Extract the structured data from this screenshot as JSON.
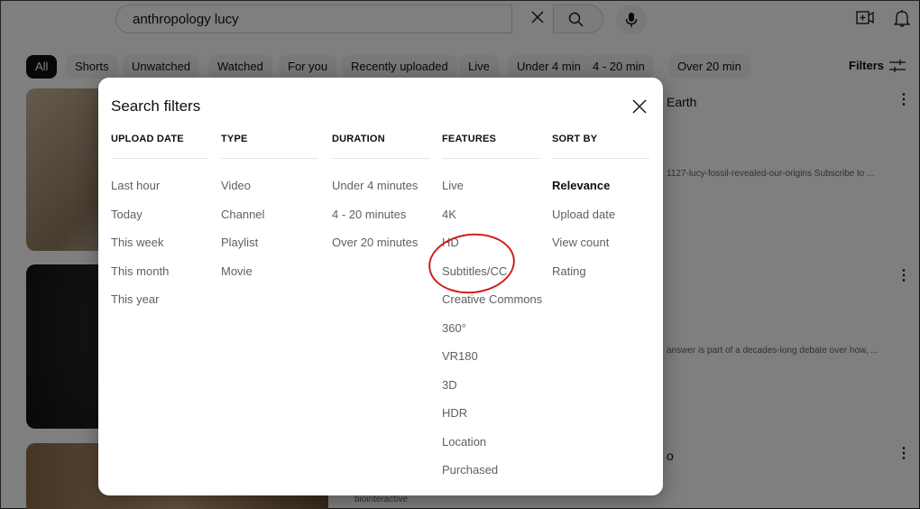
{
  "search": {
    "query": "anthropology lucy"
  },
  "chips": [
    "All",
    "Shorts",
    "Unwatched",
    "Watched",
    "For you",
    "Recently uploaded",
    "Live",
    "Under 4 min",
    "4 - 20 min",
    "Over 20 min"
  ],
  "filters_label": "Filters",
  "background": {
    "result1_title_fragment": "Earth",
    "result1_snippet_fragment": "1127-lucy-fossil-revealed-our-origins Subscribe to ...",
    "result2_snippet_fragment": "answer is part of a decades-long debate over how, ...",
    "result3_title_fragment": "o",
    "result3_channel": "biointeractive"
  },
  "dialog": {
    "title": "Search filters",
    "columns": [
      {
        "header": "UPLOAD DATE",
        "options": [
          "Last hour",
          "Today",
          "This week",
          "This month",
          "This year"
        ]
      },
      {
        "header": "TYPE",
        "options": [
          "Video",
          "Channel",
          "Playlist",
          "Movie"
        ]
      },
      {
        "header": "DURATION",
        "options": [
          "Under 4 minutes",
          "4 - 20 minutes",
          "Over 20 minutes"
        ]
      },
      {
        "header": "FEATURES",
        "options": [
          "Live",
          "4K",
          "HD",
          "Subtitles/CC",
          "Creative Commons",
          "360°",
          "VR180",
          "3D",
          "HDR",
          "Location",
          "Purchased"
        ]
      },
      {
        "header": "SORT BY",
        "options": [
          "Relevance",
          "Upload date",
          "View count",
          "Rating"
        ],
        "selected": "Relevance"
      }
    ]
  },
  "colors": {
    "annotation": "#d11f1f",
    "overlay": "rgba(0,0,0,0.5)"
  }
}
